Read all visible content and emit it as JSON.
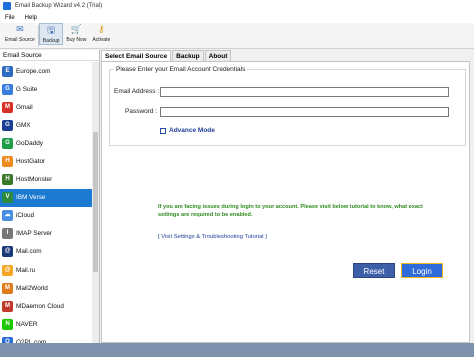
{
  "window": {
    "title": "Email Backup Wizard v4.2 (Trial)"
  },
  "menu": [
    "File",
    "Help"
  ],
  "toolbar": {
    "email_source": "Email Source",
    "backup": "Backup",
    "buy_now": "Buy Now",
    "activate": "Activate"
  },
  "sidebar": {
    "header": "Email Source",
    "items": [
      {
        "label": "Europe.com",
        "color": "#2d6cc0",
        "glyph": "E"
      },
      {
        "label": "G Suite",
        "color": "#3a7de0",
        "glyph": "G"
      },
      {
        "label": "Gmail",
        "color": "#d93025",
        "glyph": "M"
      },
      {
        "label": "GMX",
        "color": "#1c3f94",
        "glyph": "G"
      },
      {
        "label": "GoDaddy",
        "color": "#1f9e48",
        "glyph": "G"
      },
      {
        "label": "HostGator",
        "color": "#f08a1c",
        "glyph": "H"
      },
      {
        "label": "HostMonster",
        "color": "#3b7a2a",
        "glyph": "H"
      },
      {
        "label": "IBM Verse",
        "color": "#2a8a3e",
        "glyph": "V"
      },
      {
        "label": "iCloud",
        "color": "#4a90e2",
        "glyph": "☁"
      },
      {
        "label": "IMAP Server",
        "color": "#777777",
        "glyph": "I"
      },
      {
        "label": "Mail.com",
        "color": "#1a3a7a",
        "glyph": "@"
      },
      {
        "label": "Mail.ru",
        "color": "#f5a623",
        "glyph": "@"
      },
      {
        "label": "Mail2World",
        "color": "#e07b1c",
        "glyph": "M"
      },
      {
        "label": "MDaemon Cloud",
        "color": "#c0392b",
        "glyph": "M"
      },
      {
        "label": "NAVER",
        "color": "#1ec800",
        "glyph": "N"
      },
      {
        "label": "O2PL.com",
        "color": "#2a6cd6",
        "glyph": "O"
      }
    ],
    "selected_index": 7
  },
  "tabs": [
    "Select Email Source",
    "Backup",
    "About"
  ],
  "credentials": {
    "group_title": "Please Enter your Email Account Credentials",
    "email_label": "Email Address :",
    "email_value": "",
    "password_label": "Password :",
    "password_value": "",
    "advance_mode": "Advance Mode"
  },
  "info_text": "If you are facing issues during login to your account. Please visit below tutorial to know, what exact settings are required to be enabled.",
  "tutorial_link": "[ Visit Settings & Troubleshooting Tutorial ]",
  "buttons": {
    "reset": "Reset",
    "login": "Login"
  }
}
